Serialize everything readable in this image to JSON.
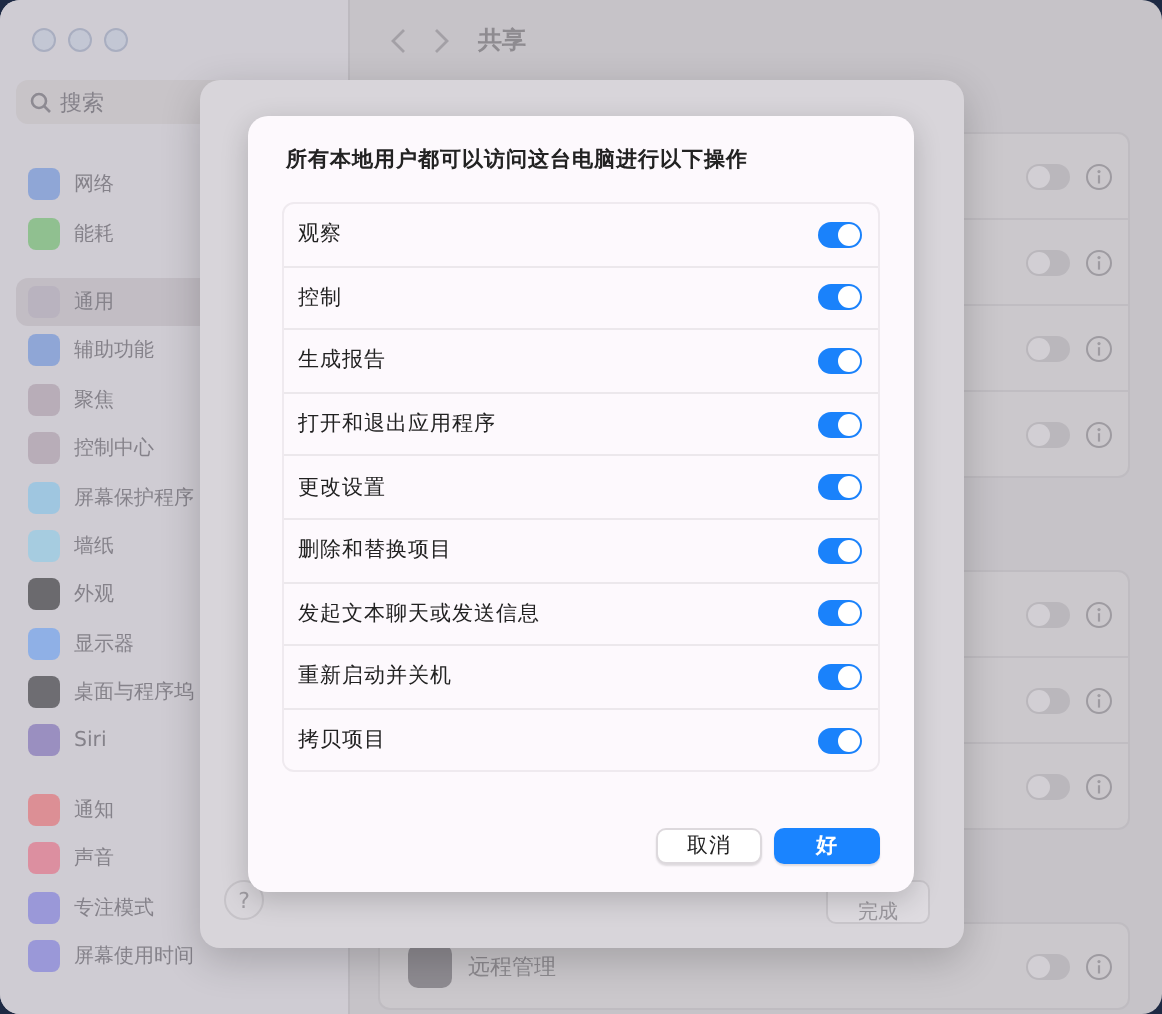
{
  "window": {
    "title": "共享"
  },
  "sidebar": {
    "search": {
      "placeholder": "搜索"
    },
    "groups": [
      {
        "items": [
          {
            "label": "网络",
            "color": "#8fa6d6",
            "selected": false
          },
          {
            "label": "能耗",
            "color": "#90c090",
            "selected": false
          }
        ]
      },
      {
        "items": [
          {
            "label": "通用",
            "color": "#b9b3bf",
            "selected": true
          },
          {
            "label": "辅助功能",
            "color": "#8fa6d6",
            "selected": false
          },
          {
            "label": "聚焦",
            "color": "#b8adb8",
            "selected": false
          },
          {
            "label": "控制中心",
            "color": "#b8adb8",
            "selected": false
          },
          {
            "label": "屏幕保护程序",
            "color": "#9fc6e0",
            "selected": false
          },
          {
            "label": "墙纸",
            "color": "#a6cce0",
            "selected": false
          },
          {
            "label": "外观",
            "color": "#6b6a6e",
            "selected": false
          },
          {
            "label": "显示器",
            "color": "#8fb0e6",
            "selected": false
          },
          {
            "label": "桌面与程序坞",
            "color": "#6e6d72",
            "selected": false
          },
          {
            "label": "Siri",
            "color": "#9a8fc0",
            "selected": false
          }
        ]
      },
      {
        "items": [
          {
            "label": "通知",
            "color": "#dc8f95",
            "selected": false
          },
          {
            "label": "声音",
            "color": "#dc8fa0",
            "selected": false
          },
          {
            "label": "专注模式",
            "color": "#9a98d8",
            "selected": false
          },
          {
            "label": "屏幕使用时间",
            "color": "#9a98d8",
            "selected": false
          }
        ]
      }
    ]
  },
  "main": {
    "groups": [
      {
        "rows": [
          {
            "on": false
          },
          {
            "on": false
          },
          {
            "on": false
          },
          {
            "on": false
          }
        ]
      },
      {
        "rows": [
          {
            "on": false
          },
          {
            "on": false
          },
          {
            "on": false
          }
        ]
      },
      {
        "rows": [
          {
            "label": "远程管理",
            "on": false
          }
        ]
      }
    ]
  },
  "outer_sheet": {
    "help_button": "?",
    "done_button": "完成"
  },
  "dialog": {
    "title": "所有本地用户都可以访问这台电脑进行以下操作",
    "permissions": [
      {
        "label": "观察",
        "on": true
      },
      {
        "label": "控制",
        "on": true
      },
      {
        "label": "生成报告",
        "on": true
      },
      {
        "label": "打开和退出应用程序",
        "on": true
      },
      {
        "label": "更改设置",
        "on": true
      },
      {
        "label": "删除和替换项目",
        "on": true
      },
      {
        "label": "发起文本聊天或发送信息",
        "on": true
      },
      {
        "label": "重新启动并关机",
        "on": true
      },
      {
        "label": "拷贝项目",
        "on": true
      }
    ],
    "buttons": [
      {
        "label": "取消",
        "kind": "secondary"
      },
      {
        "label": "好",
        "kind": "primary"
      }
    ]
  }
}
